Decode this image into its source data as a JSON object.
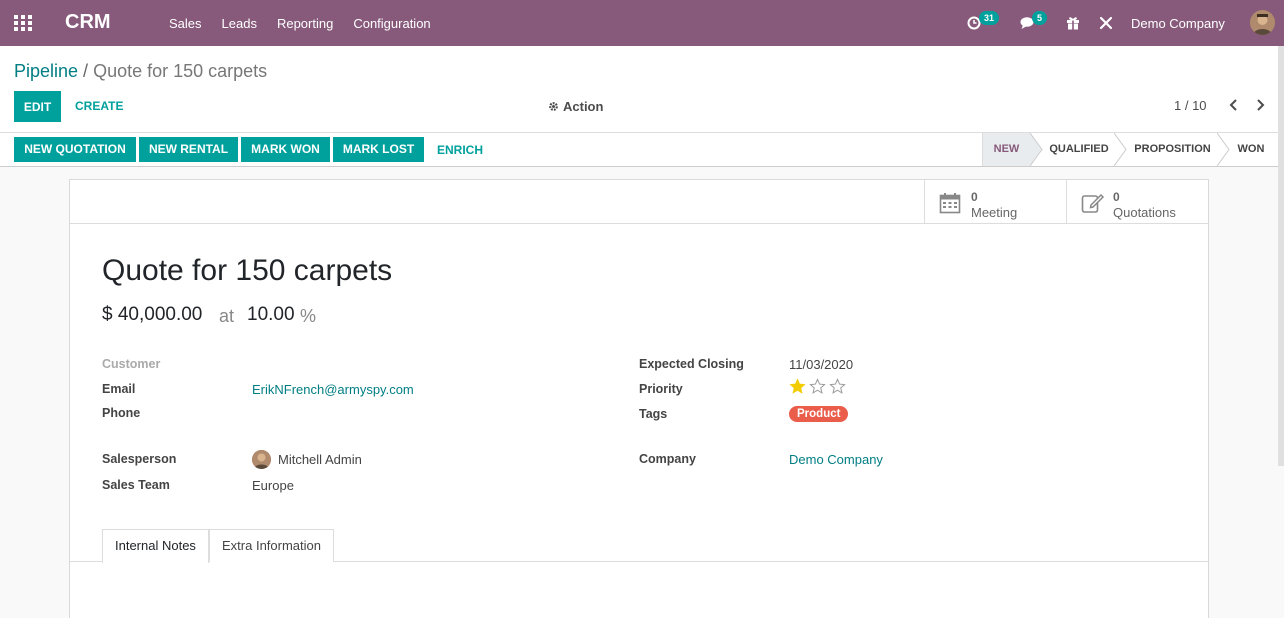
{
  "navbar": {
    "brand": "CRM",
    "menu": [
      "Sales",
      "Leads",
      "Reporting",
      "Configuration"
    ],
    "activity_count": "31",
    "message_count": "5",
    "company": "Demo Company"
  },
  "breadcrumb": {
    "parent": "Pipeline",
    "separator": "/",
    "current": "Quote for 150 carpets"
  },
  "control": {
    "edit_label": "EDIT",
    "create_label": "CREATE",
    "action_label": "Action",
    "pager": "1 / 10"
  },
  "status_buttons": {
    "new_quotation": "NEW QUOTATION",
    "new_rental": "NEW RENTAL",
    "mark_won": "MARK WON",
    "mark_lost": "MARK LOST",
    "enrich": "ENRICH"
  },
  "stages": {
    "new": "NEW",
    "qualified": "QUALIFIED",
    "proposition": "PROPOSITION",
    "won": "WON",
    "active": "NEW"
  },
  "smart_buttons": {
    "meeting_count": "0",
    "meeting_label": "Meeting",
    "quotations_count": "0",
    "quotations_label": "Quotations"
  },
  "record": {
    "title": "Quote for 150 carpets",
    "revenue": "$ 40,000.00",
    "at": "at",
    "probability": "10.00",
    "percent": "%"
  },
  "fields": {
    "customer_label": "Customer",
    "email_label": "Email",
    "email": "ErikNFrench@armyspy.com",
    "phone_label": "Phone",
    "salesperson_label": "Salesperson",
    "salesperson": "Mitchell Admin",
    "sales_team_label": "Sales Team",
    "sales_team": "Europe",
    "expected_closing_label": "Expected Closing",
    "expected_closing": "11/03/2020",
    "priority_label": "Priority",
    "priority": 1,
    "priority_max": 3,
    "tags_label": "Tags",
    "tag": "Product",
    "company_label": "Company",
    "company": "Demo Company"
  },
  "tabs": {
    "internal_notes": "Internal Notes",
    "extra_info": "Extra Information"
  },
  "colors": {
    "navbar": "#875a7b",
    "primary": "#00a09d",
    "link": "#017e84",
    "tag": "#e95d4a",
    "star": "#f3cc00"
  }
}
